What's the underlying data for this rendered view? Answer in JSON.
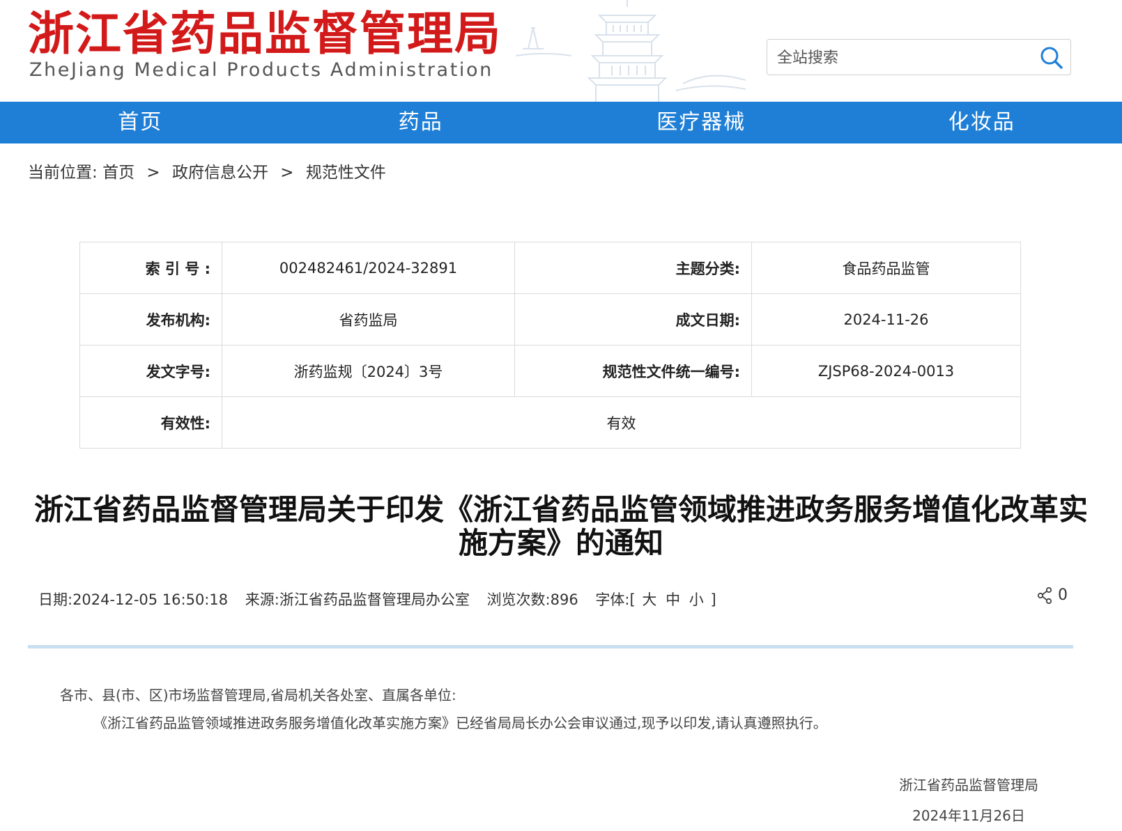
{
  "header": {
    "logo_cn": "浙江省药品监督管理局",
    "logo_en": "ZheJiang Medical Products Administration",
    "search_placeholder": "全站搜索"
  },
  "nav": {
    "items": [
      {
        "label": "首页"
      },
      {
        "label": "药品"
      },
      {
        "label": "医疗器械"
      },
      {
        "label": "化妆品"
      }
    ]
  },
  "breadcrumb": {
    "prefix": "当前位置:",
    "items": [
      "首页",
      "政府信息公开",
      "规范性文件"
    ],
    "separator": ">"
  },
  "meta": {
    "index_label": "索 引 号 :",
    "index_value": "002482461/2024-32891",
    "topic_label": "主题分类:",
    "topic_value": "食品药品监管",
    "publisher_label": "发布机构:",
    "publisher_value": "省药监局",
    "date_label": "成文日期:",
    "date_value": "2024-11-26",
    "docno_label": "发文字号:",
    "docno_value": "浙药监规〔2024〕3号",
    "unified_label": "规范性文件统一编号:",
    "unified_value": "ZJSP68-2024-0013",
    "validity_label": "有效性:",
    "validity_value": "有效"
  },
  "article": {
    "title": "浙江省药品监督管理局关于印发《浙江省药品监管领域推进政务服务增值化改革实施方案》的通知",
    "date_text": "日期:2024-12-05 16:50:18",
    "source_text": "来源:浙江省药品监督管理局办公室",
    "views_text": "浏览次数:896",
    "font_label": "字体:[",
    "font_large": "大",
    "font_medium": "中",
    "font_small": "小",
    "font_close": "]",
    "share_count": "0",
    "salutation": "各市、县(市、区)市场监督管理局,省局机关各处室、直属各单位:",
    "paragraph": "《浙江省药品监管领域推进政务服务增值化改革实施方案》已经省局局长办公会审议通过,现予以印发,请认真遵照执行。",
    "signature_org": "浙江省药品监督管理局",
    "signature_date": "2024年11月26日"
  },
  "colors": {
    "brand_red": "#d31a1a",
    "nav_blue": "#1f7fd6",
    "divider": "#c9dff1"
  },
  "icons": {
    "search": "search-icon",
    "share": "share-icon",
    "pagoda": "pagoda-illustration"
  }
}
